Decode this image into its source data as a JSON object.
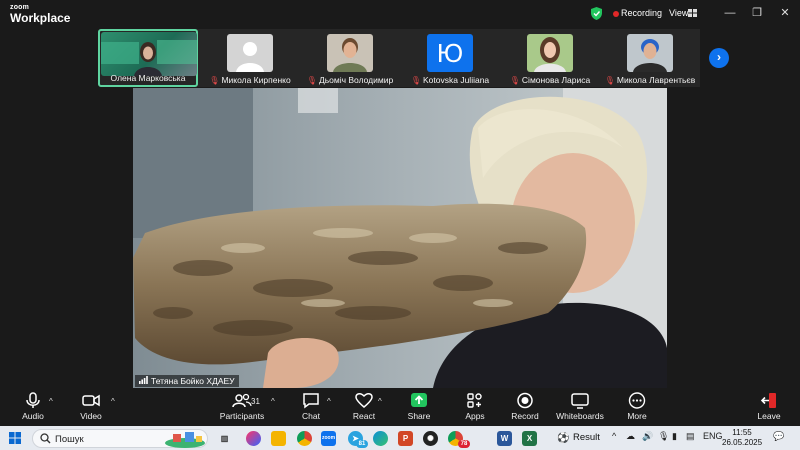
{
  "app": {
    "brand_small": "zoom",
    "brand_big": "Workplace"
  },
  "header": {
    "recording_label": "Recording",
    "view_label": "View"
  },
  "participants_strip": [
    {
      "name": "Олена Марковська",
      "muted": false
    },
    {
      "name": "Микола Кирпенко",
      "muted": true
    },
    {
      "name": "Дьоміч Володимир",
      "muted": true
    },
    {
      "name": "Kotovska Juliiana",
      "muted": true,
      "initial": "Ю"
    },
    {
      "name": "Сімонова Лариса",
      "muted": true
    },
    {
      "name": "Микола Лаврентьєв",
      "muted": true
    }
  ],
  "main_video": {
    "speaker_name": "Тетяна Бойко ХДАЕУ"
  },
  "toolbar": {
    "audio": "Audio",
    "video": "Video",
    "participants": "Participants",
    "participants_count": "31",
    "chat": "Chat",
    "react": "React",
    "share": "Share",
    "apps": "Apps",
    "record": "Record",
    "whiteboards": "Whiteboards",
    "more": "More",
    "leave": "Leave"
  },
  "taskbar": {
    "search_placeholder": "Пошук",
    "telegram_badge": "81",
    "chrome_badge": "78",
    "result_label": "Result",
    "language": "ENG",
    "time": "11:55",
    "date": "26.05.2025"
  },
  "colors": {
    "accent_blue": "#0e72ed",
    "share_green": "#22c55e",
    "leave_red": "#e02828",
    "active_border": "#5fd4a0"
  }
}
